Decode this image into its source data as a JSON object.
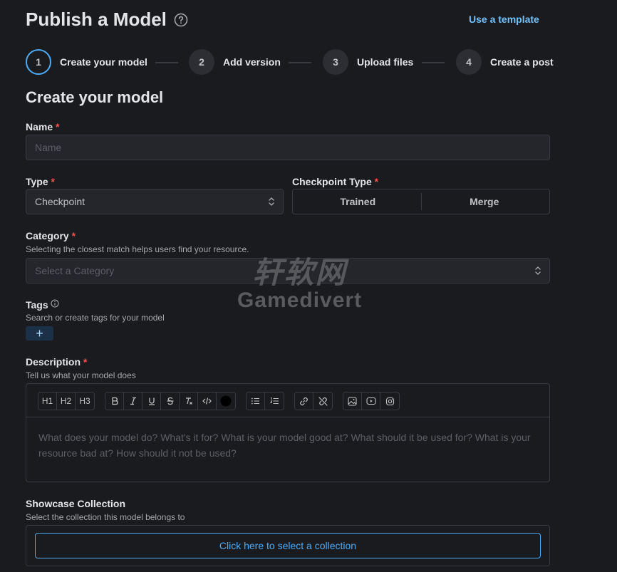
{
  "header": {
    "title": "Publish a Model",
    "template_link": "Use a template"
  },
  "steps": [
    {
      "number": "1",
      "label": "Create your model"
    },
    {
      "number": "2",
      "label": "Add version"
    },
    {
      "number": "3",
      "label": "Upload files"
    },
    {
      "number": "4",
      "label": "Create a post"
    }
  ],
  "section_title": "Create your model",
  "form": {
    "name": {
      "label": "Name",
      "required": "*",
      "placeholder": "Name"
    },
    "type": {
      "label": "Type",
      "required": "*",
      "value": "Checkpoint"
    },
    "checkpoint_type": {
      "label": "Checkpoint Type",
      "required": "*",
      "options": [
        "Trained",
        "Merge"
      ]
    },
    "category": {
      "label": "Category",
      "required": "*",
      "description": "Selecting the closest match helps users find your resource.",
      "placeholder": "Select a Category"
    },
    "tags": {
      "label": "Tags",
      "description": "Search or create tags for your model",
      "add_label": "+"
    },
    "description": {
      "label": "Description",
      "required": "*",
      "description": "Tell us what your model does",
      "toolbar_headings": [
        "H1",
        "H2",
        "H3"
      ],
      "placeholder": "What does your model do? What's it for? What is your model good at? What should it be used for? What is your resource bad at? How should it not be used?"
    },
    "showcase": {
      "label": "Showcase Collection",
      "description": "Select the collection this model belongs to",
      "button_label": "Click here to select a collection"
    }
  },
  "watermark": {
    "cn": "轩软网",
    "en": "Gamedivert"
  },
  "colors": {
    "accent": "#4dabf7",
    "link": "#74c0fc",
    "required": "#fa5252",
    "background": "#1a1b1e"
  }
}
